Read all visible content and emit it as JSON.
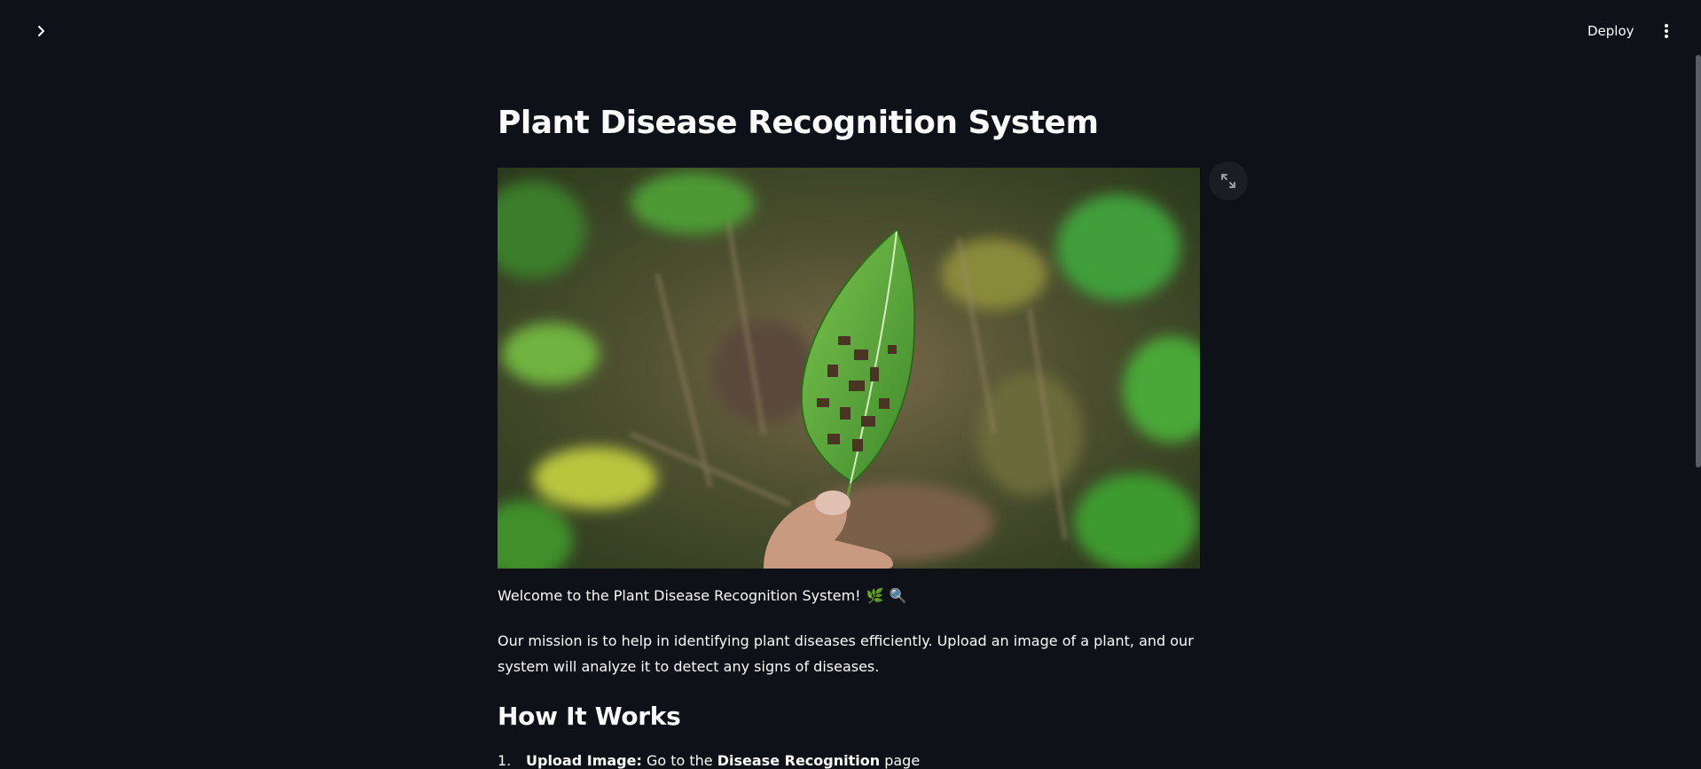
{
  "header": {
    "deploy_label": "Deploy",
    "sidebar_toggle_icon": "chevron-right-icon",
    "menu_icon": "vertical-ellipsis-icon"
  },
  "main": {
    "title": "Plant Disease Recognition System",
    "hero_image": "diseased-leaf-photo",
    "fullscreen_icon": "expand-icon",
    "welcome_text": "Welcome to the Plant Disease Recognition System!",
    "welcome_emoji_1": "🌿",
    "welcome_emoji_2": "🔍",
    "mission_text": "Our mission is to help in identifying plant diseases efficiently. Upload an image of a plant, and our system will analyze it to detect any signs of diseases.",
    "how_title": "How It Works",
    "steps": [
      {
        "number": "1.",
        "bold_lead": "Upload Image:",
        "text": " Go to the ",
        "bold_link": "Disease Recognition",
        "tail": " page"
      }
    ]
  },
  "colors": {
    "background": "#0e1117",
    "text": "#fafafa",
    "scrollbar": "#5a5d66"
  }
}
